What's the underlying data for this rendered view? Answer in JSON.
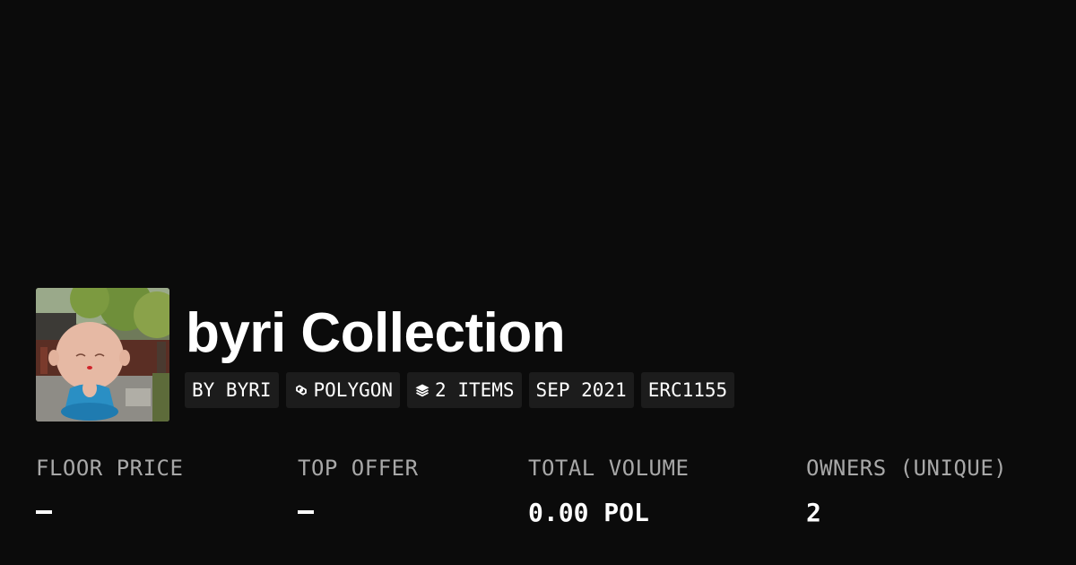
{
  "collection": {
    "name": "byri Collection",
    "tags": [
      {
        "label": "BY BYRI",
        "icon": ""
      },
      {
        "label": "POLYGON",
        "icon": "polygon-icon"
      },
      {
        "label": "2 ITEMS",
        "icon": "layers-icon"
      },
      {
        "label": "SEP 2021",
        "icon": ""
      },
      {
        "label": "ERC1155",
        "icon": ""
      }
    ]
  },
  "stats": [
    {
      "label": "FLOOR PRICE",
      "value": "—"
    },
    {
      "label": "TOP OFFER",
      "value": "—"
    },
    {
      "label": "TOTAL VOLUME",
      "value": "0.00 POL"
    },
    {
      "label": "OWNERS (UNIQUE)",
      "value": "2"
    }
  ],
  "colors": {
    "background": "#0b0b0b",
    "tag_background": "#1c1c1c",
    "label_gray": "#a8a8a8",
    "text": "#ffffff"
  }
}
